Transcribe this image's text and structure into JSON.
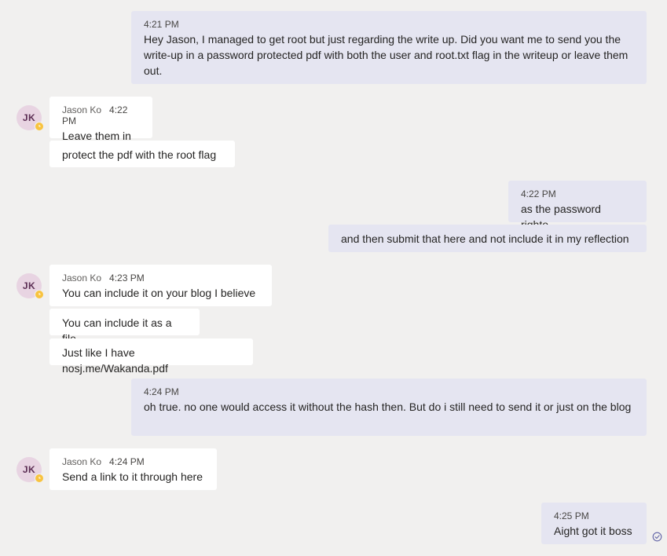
{
  "conversation": {
    "messages": [
      {
        "direction": "outgoing",
        "time": "4:21 PM",
        "text": "Hey Jason, I managed to get root but just regarding the write up. Did you want me to send you the write-up in a password protected pdf with both the user and root.txt flag in the writeup or leave them out."
      },
      {
        "direction": "incoming",
        "author": "Jason Ko",
        "initials": "JK",
        "time": "4:22 PM",
        "text": "Leave them in",
        "followups": [
          "protect the pdf with the root flag"
        ]
      },
      {
        "direction": "outgoing",
        "time": "4:22 PM",
        "text": "as the password righto.",
        "followups": [
          "and then submit that here and not include it in my reflection"
        ]
      },
      {
        "direction": "incoming",
        "author": "Jason Ko",
        "initials": "JK",
        "time": "4:23 PM",
        "text": "You can include it on your blog I believe",
        "followups": [
          "You can include it as a file",
          "Just like I have nosj.me/Wakanda.pdf"
        ]
      },
      {
        "direction": "outgoing",
        "time": "4:24 PM",
        "text": "oh true. no one would access it without the hash then. But do i still need to send it or just on the blog"
      },
      {
        "direction": "incoming",
        "author": "Jason Ko",
        "initials": "JK",
        "time": "4:24 PM",
        "text": "Send a link to it through here"
      },
      {
        "direction": "outgoing",
        "time": "4:25 PM",
        "text": "Aight got it boss",
        "status_icon": "read-receipt-icon"
      }
    ]
  },
  "colors": {
    "background": "#f1f0ef",
    "outgoing_bubble": "#e5e5f1",
    "incoming_bubble": "#ffffff",
    "avatar_bg": "#e8d4e2",
    "avatar_text": "#5c2e54",
    "away_status": "#f8c33f",
    "read_receipt": "#6264a7"
  },
  "icons": {
    "avatar_status": "away-clock-icon",
    "read_receipt": "read-receipt-icon"
  }
}
